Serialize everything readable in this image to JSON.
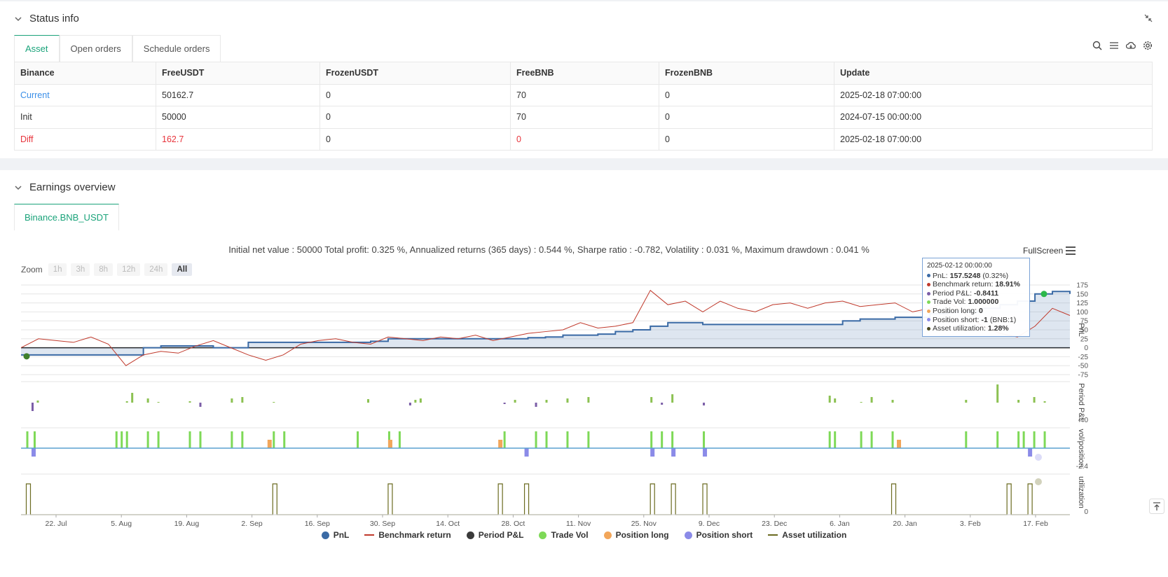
{
  "status_panel": {
    "title": "Status info",
    "tabs": [
      "Asset",
      "Open orders",
      "Schedule orders"
    ],
    "active_tab": "Asset",
    "table": {
      "headers": [
        "Binance",
        "FreeUSDT",
        "FrozenUSDT",
        "FreeBNB",
        "FrozenBNB",
        "Update"
      ],
      "rows": [
        [
          "Current",
          "50162.7",
          "0",
          "70",
          "0",
          "2025-02-18 07:00:00"
        ],
        [
          "Init",
          "50000",
          "0",
          "70",
          "0",
          "2024-07-15 00:00:00"
        ],
        [
          "Diff",
          "162.7",
          "0",
          "0",
          "0",
          "2025-02-18 07:00:00"
        ]
      ]
    }
  },
  "earnings_panel": {
    "title": "Earnings overview",
    "tab": "Binance.BNB_USDT",
    "summary": "Initial net value : 50000 Total profit: 0.325 %, Annualized returns (365 days) : 0.544 %, Sharpe ratio : -0.782, Volatility : 0.031 %, Maximum drawdown : 0.041 %",
    "fullscreen_label": "FullScreen",
    "zoom_label": "Zoom",
    "zoom_buttons": [
      "1h",
      "3h",
      "8h",
      "12h",
      "24h",
      "All"
    ],
    "zoom_active": "All"
  },
  "tooltip": {
    "date": "2025-02-12 00:00:00",
    "rows": [
      {
        "label": "PnL: ",
        "value": "157.5248",
        "extra": " (0.32%)",
        "color": "#3a6aa5"
      },
      {
        "label": "Benchmark return: ",
        "value": "18.91%",
        "extra": "",
        "color": "#c0392b"
      },
      {
        "label": "Period P&L: ",
        "value": "-0.8411",
        "extra": "",
        "color": "#7b5ea7"
      },
      {
        "label": "Trade Vol: ",
        "value": "1.000000",
        "extra": "",
        "color": "#7ed957"
      },
      {
        "label": "Position long: ",
        "value": "0",
        "extra": "",
        "color": "#f2a65a"
      },
      {
        "label": "Position short: ",
        "value": "-1",
        "extra": " (BNB:1)",
        "color": "#8b8be8"
      },
      {
        "label": "Asset utilization: ",
        "value": "1.28%",
        "extra": "",
        "color": "#4a4a20"
      }
    ]
  },
  "chart_data": {
    "type": "line",
    "x_ticks": [
      "22. Jul",
      "5. Aug",
      "19. Aug",
      "2. Sep",
      "16. Sep",
      "30. Sep",
      "14. Oct",
      "28. Oct",
      "11. Nov",
      "25. Nov",
      "9. Dec",
      "23. Dec",
      "6. Jan",
      "20. Jan",
      "3. Feb",
      "17. Feb"
    ],
    "pnl_axis": {
      "label": "PnL",
      "ticks": [
        "175",
        "150",
        "125",
        "100",
        "75",
        "50",
        "25",
        "0",
        "-25",
        "-50",
        "-75"
      ],
      "ylim": [
        -75,
        175
      ]
    },
    "period_axis": {
      "label": "Period P&L",
      "ticks": [
        "-40"
      ]
    },
    "vol_axis": {
      "label": "vol/position",
      "ticks": [
        "-2.4"
      ]
    },
    "util_axis": {
      "label": "utilization",
      "ticks": [
        "0"
      ]
    },
    "series": [
      {
        "name": "PnL",
        "color": "#3a6aa5",
        "values": [
          -20,
          -20,
          -20,
          -20,
          -20,
          -20,
          -20,
          0,
          5,
          5,
          5,
          0,
          0,
          15,
          15,
          15,
          15,
          15,
          15,
          15,
          18,
          25,
          25,
          25,
          25,
          25,
          25,
          25,
          25,
          28,
          30,
          35,
          35,
          38,
          45,
          50,
          60,
          70,
          70,
          65,
          65,
          65,
          65,
          65,
          65,
          65,
          65,
          75,
          80,
          80,
          85,
          85,
          95,
          100,
          100,
          110,
          120,
          130,
          150,
          157,
          150
        ]
      },
      {
        "name": "Benchmark return",
        "color": "#c0392b",
        "values": [
          0,
          25,
          20,
          15,
          30,
          10,
          -50,
          -20,
          -10,
          -15,
          5,
          20,
          0,
          -20,
          -35,
          -20,
          10,
          20,
          25,
          15,
          10,
          30,
          25,
          20,
          30,
          25,
          35,
          20,
          30,
          40,
          45,
          50,
          70,
          55,
          60,
          70,
          160,
          120,
          130,
          100,
          130,
          110,
          100,
          120,
          125,
          110,
          125,
          130,
          115,
          120,
          125,
          100,
          110,
          130,
          95,
          60,
          40,
          30,
          60,
          110,
          90
        ]
      },
      {
        "name": "Period P&L",
        "color": "#4a4a4a",
        "values": []
      },
      {
        "name": "Trade Vol",
        "color": "#7ed957",
        "values": []
      },
      {
        "name": "Position long",
        "color": "#f2a65a",
        "values": []
      },
      {
        "name": "Position short",
        "color": "#8b8be8",
        "values": []
      },
      {
        "name": "Asset utilization",
        "color": "#6b6b20",
        "values": []
      }
    ],
    "period_pnl_bars": [
      {
        "x": 0.01,
        "v": -12
      },
      {
        "x": 0.015,
        "v": 3
      },
      {
        "x": 0.1,
        "v": 2
      },
      {
        "x": 0.105,
        "v": 14
      },
      {
        "x": 0.12,
        "v": 6
      },
      {
        "x": 0.13,
        "v": 1
      },
      {
        "x": 0.16,
        "v": 2
      },
      {
        "x": 0.17,
        "v": -6
      },
      {
        "x": 0.2,
        "v": 6
      },
      {
        "x": 0.21,
        "v": 8
      },
      {
        "x": 0.24,
        "v": 1
      },
      {
        "x": 0.33,
        "v": 5
      },
      {
        "x": 0.37,
        "v": -4
      },
      {
        "x": 0.375,
        "v": 4
      },
      {
        "x": 0.38,
        "v": 6
      },
      {
        "x": 0.46,
        "v": -2
      },
      {
        "x": 0.47,
        "v": 4
      },
      {
        "x": 0.49,
        "v": -6
      },
      {
        "x": 0.5,
        "v": 4
      },
      {
        "x": 0.52,
        "v": 6
      },
      {
        "x": 0.54,
        "v": 8
      },
      {
        "x": 0.6,
        "v": 8
      },
      {
        "x": 0.61,
        "v": -3
      },
      {
        "x": 0.62,
        "v": 12
      },
      {
        "x": 0.65,
        "v": -4
      },
      {
        "x": 0.77,
        "v": 10
      },
      {
        "x": 0.775,
        "v": 6
      },
      {
        "x": 0.8,
        "v": 1
      },
      {
        "x": 0.81,
        "v": 8
      },
      {
        "x": 0.83,
        "v": 4
      },
      {
        "x": 0.9,
        "v": 4
      },
      {
        "x": 0.93,
        "v": 26
      },
      {
        "x": 0.95,
        "v": 4
      },
      {
        "x": 0.965,
        "v": 8
      },
      {
        "x": 0.975,
        "v": 2
      }
    ],
    "trade_vol_bars": [
      0.005,
      0.012,
      0.09,
      0.095,
      0.1,
      0.12,
      0.13,
      0.16,
      0.17,
      0.2,
      0.21,
      0.24,
      0.25,
      0.32,
      0.35,
      0.36,
      0.46,
      0.49,
      0.5,
      0.52,
      0.54,
      0.6,
      0.61,
      0.62,
      0.65,
      0.77,
      0.775,
      0.8,
      0.81,
      0.83,
      0.9,
      0.93,
      0.95,
      0.955,
      0.965,
      0.975
    ],
    "position_long_bars": [
      0.235,
      0.35,
      0.455,
      0.835
    ],
    "position_short_bars": [
      0.01,
      0.48,
      0.6,
      0.62,
      0.65,
      0.96
    ],
    "utilization_spikes": [
      0.005,
      0.24,
      0.35,
      0.455,
      0.48,
      0.6,
      0.62,
      0.65,
      0.83,
      0.94,
      0.96
    ]
  }
}
